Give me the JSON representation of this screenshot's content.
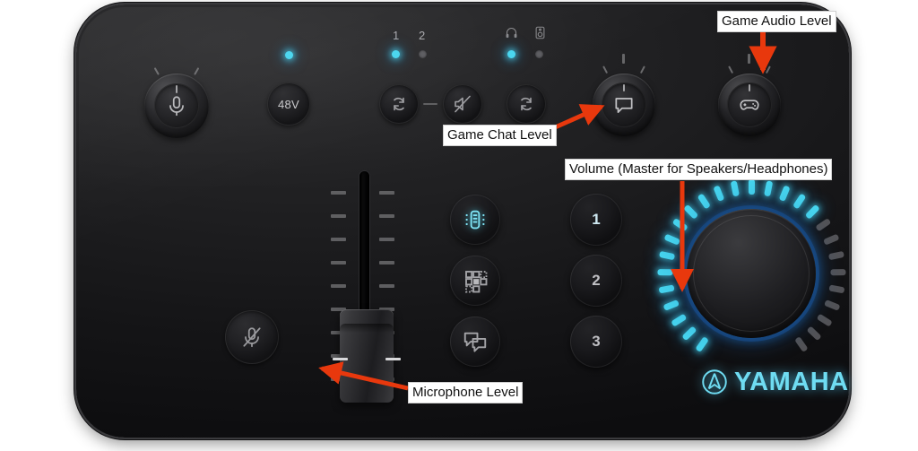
{
  "device": {
    "brand": "YAMAHA",
    "product_type": "audio-interface-mixer",
    "accent_color": "#47d5ef",
    "glow_color": "#1c6cbe",
    "body_color": "#1a1a1c",
    "annotation_color": "#e8380d",
    "background_color": "#ffffff"
  },
  "annotations": [
    {
      "id": "game-audio",
      "label": "Game Audio Level",
      "target": "game-audio-knob",
      "arrow": "down"
    },
    {
      "id": "game-chat",
      "label": "Game Chat Level",
      "target": "game-chat-knob",
      "arrow": "up-right"
    },
    {
      "id": "volume",
      "label": "Volume (Master for Speakers/Headphones)",
      "target": "volume-knob",
      "arrow": "down"
    },
    {
      "id": "microphone",
      "label": "Microphone Level",
      "target": "fader-cap",
      "arrow": "left"
    }
  ],
  "controls": {
    "mic_gain_knob": {
      "icon": "microphone-icon",
      "name": "Mic Gain",
      "pointer_deg": 0
    },
    "phantom_button": {
      "label": "48V",
      "icon": "phantom-power",
      "led": "on"
    },
    "mic_mute_button": {
      "icon": "microphone-muted-icon",
      "led": "off"
    },
    "loop_left_button": {
      "icon": "loopback-icon"
    },
    "separator": {
      "icon": "dash-icon"
    },
    "mute_mid_button": {
      "icon": "speaker-muted-icon"
    },
    "loop_right_button": {
      "icon": "loopback-icon"
    },
    "game_chat_knob": {
      "icon": "speech-bubble-icon",
      "name": "Game Chat",
      "pointer_deg": 0
    },
    "game_audio_knob": {
      "icon": "gamepad-icon",
      "name": "Game Audio",
      "pointer_deg": 0
    },
    "volume_knob": {
      "name": "Volume",
      "led_segments_total": 27,
      "led_segments_lit": 18
    },
    "fader": {
      "name": "Microphone Level",
      "tick_count": 9,
      "position_percent": 22
    }
  },
  "indicators": {
    "input_group": {
      "items": [
        {
          "label": "1",
          "led": "on"
        },
        {
          "label": "2",
          "led": "off"
        }
      ]
    },
    "output_group": {
      "items": [
        {
          "icon": "headphones-icon",
          "led": "on"
        },
        {
          "icon": "speaker-icon",
          "led": "off"
        }
      ]
    },
    "phantom_led": {
      "led": "on"
    }
  },
  "effect_buttons": [
    {
      "id": "voice",
      "icon": "voice-changer-icon",
      "lit": true
    },
    {
      "id": "pad",
      "icon": "sound-pad-grid-icon",
      "lit": false
    },
    {
      "id": "chat",
      "icon": "chat-bubbles-icon",
      "lit": false
    }
  ],
  "preset_buttons": [
    {
      "label": "1",
      "lit": true
    },
    {
      "label": "2",
      "lit": false
    },
    {
      "label": "3",
      "lit": false
    }
  ]
}
